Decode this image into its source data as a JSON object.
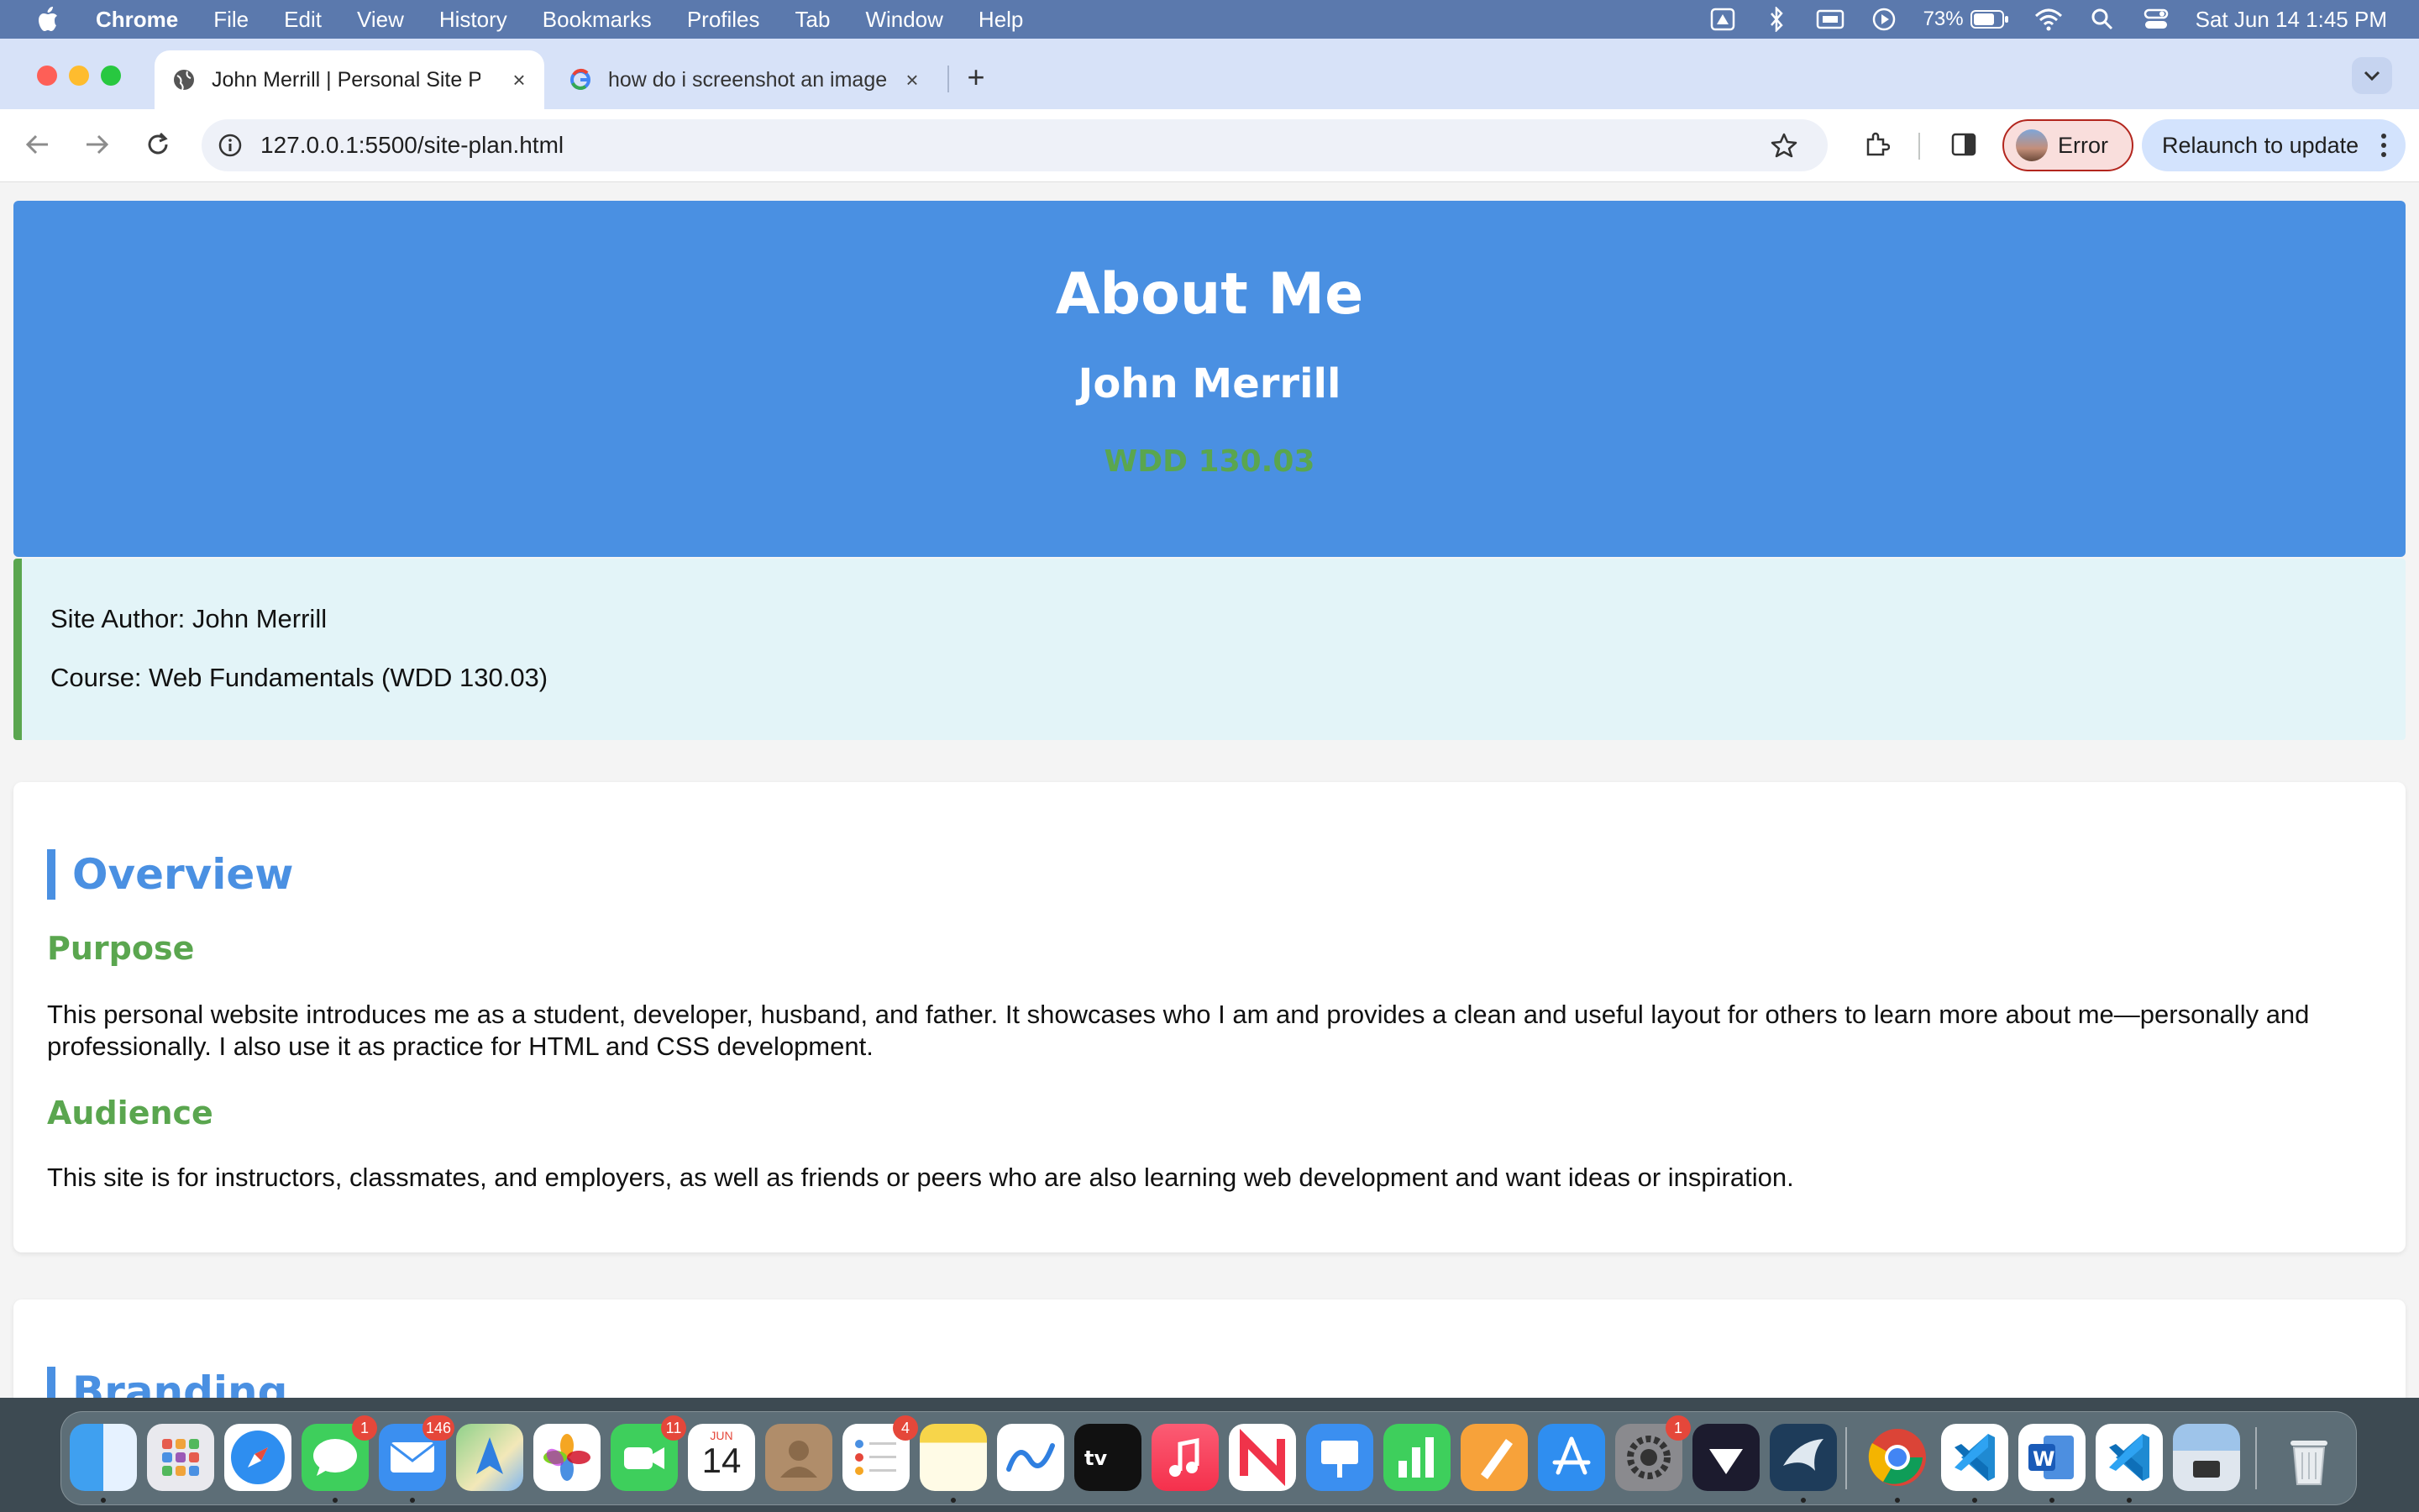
{
  "menubar": {
    "app_name": "Chrome",
    "items": [
      "File",
      "Edit",
      "View",
      "History",
      "Bookmarks",
      "Profiles",
      "Tab",
      "Window",
      "Help"
    ],
    "battery": "73%",
    "datetime": "Sat Jun 14  1:45 PM"
  },
  "tabs": [
    {
      "title": "John Merrill | Personal Site Plan",
      "active": true
    },
    {
      "title": "how do i screenshot an image",
      "active": false
    }
  ],
  "toolbar": {
    "url": "127.0.0.1:5500/site-plan.html",
    "profile_label": "Error",
    "relaunch_label": "Relaunch to update"
  },
  "hero": {
    "title": "About Me",
    "name": "John Merrill",
    "course_code": "WDD 130.03"
  },
  "info": {
    "author": "Site Author: John Merrill",
    "course": "Course: Web Fundamentals (WDD 130.03)"
  },
  "overview": {
    "heading": "Overview",
    "purpose_heading": "Purpose",
    "purpose_text": "This personal website introduces me as a student, developer, husband, and father. It showcases who I am and provides a clean and useful layout for others to learn more about me—personally and professionally. I also use it as practice for HTML and CSS development.",
    "audience_heading": "Audience",
    "audience_text": "This site is for instructors, classmates, and employers, as well as friends or peers who are also learning web development and want ideas or inspiration."
  },
  "branding": {
    "heading": "Branding"
  },
  "dock": {
    "badges": {
      "messages": "1",
      "mail": "146",
      "facetime": "11",
      "reminders": "4",
      "settings": "1"
    },
    "calendar_month": "JUN",
    "calendar_day": "14"
  }
}
